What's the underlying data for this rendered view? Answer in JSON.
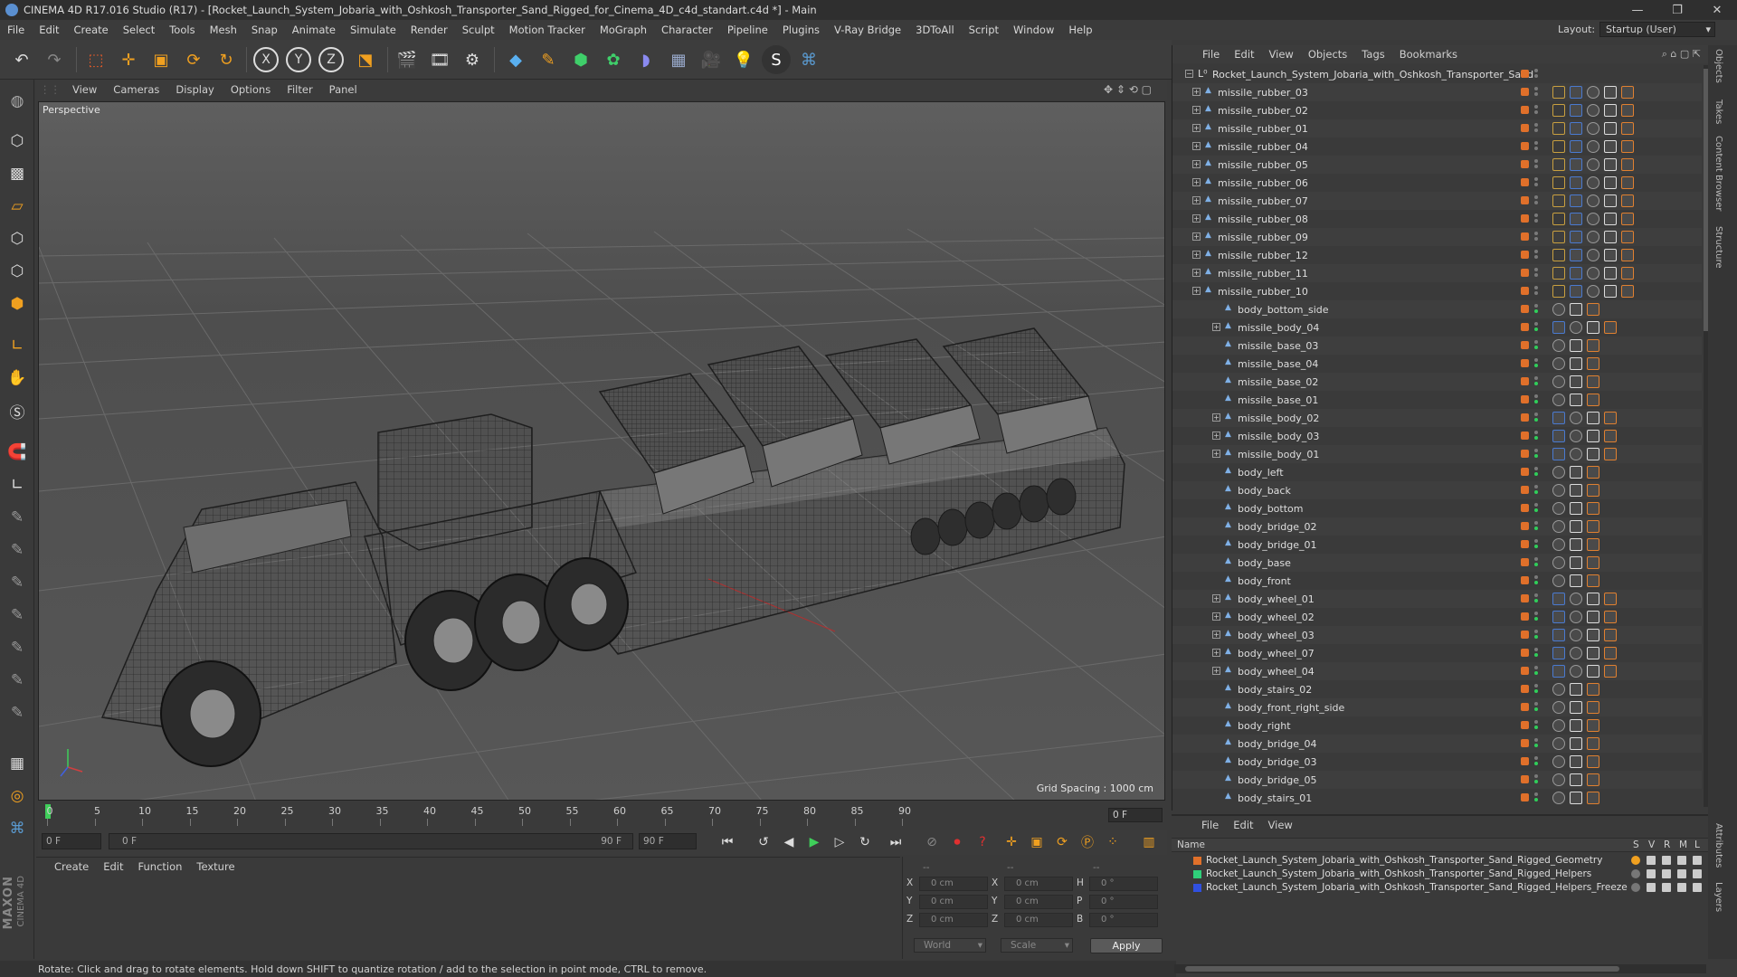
{
  "window": {
    "title": "CINEMA 4D R17.016 Studio (R17) - [Rocket_Launch_System_Jobaria_with_Oshkosh_Transporter_Sand_Rigged_for_Cinema_4D_c4d_standart.c4d *] - Main",
    "minimize": "—",
    "restore": "❐",
    "close": "✕"
  },
  "menubar": [
    "File",
    "Edit",
    "Create",
    "Select",
    "Tools",
    "Mesh",
    "Snap",
    "Animate",
    "Simulate",
    "Render",
    "Sculpt",
    "Motion Tracker",
    "MoGraph",
    "Character",
    "Pipeline",
    "Plugins",
    "V-Ray Bridge",
    "3DToAll",
    "Script",
    "Window",
    "Help"
  ],
  "layout": {
    "label": "Layout:",
    "value": "Startup (User)"
  },
  "viewport": {
    "menu": [
      "View",
      "Cameras",
      "Display",
      "Options",
      "Filter",
      "Panel"
    ],
    "label": "Perspective",
    "grid_spacing": "Grid Spacing : 1000 cm"
  },
  "timeline": {
    "ticks": [
      "0",
      "5",
      "10",
      "15",
      "20",
      "25",
      "30",
      "35",
      "40",
      "45",
      "50",
      "55",
      "60",
      "65",
      "70",
      "75",
      "80",
      "85",
      "90"
    ],
    "current_frame": "0 F"
  },
  "transport": {
    "start": "0 F",
    "slider_start": "0 F",
    "slider_end": "90 F",
    "end": "90 F"
  },
  "material_panel": {
    "menu": [
      "Create",
      "Edit",
      "Function",
      "Texture"
    ]
  },
  "coords": {
    "dash1": "--",
    "dash2": "--",
    "dash3": "--",
    "rows": [
      {
        "a": "X",
        "av": "0 cm",
        "b": "X",
        "bv": "0 cm",
        "c": "H",
        "cv": "0 °"
      },
      {
        "a": "Y",
        "av": "0 cm",
        "b": "Y",
        "bv": "0 cm",
        "c": "P",
        "cv": "0 °"
      },
      {
        "a": "Z",
        "av": "0 cm",
        "b": "Z",
        "bv": "0 cm",
        "c": "B",
        "cv": "0 °"
      }
    ],
    "world": "World",
    "scale": "Scale",
    "apply": "Apply"
  },
  "status": "Rotate: Click and drag to rotate elements. Hold down SHIFT to quantize rotation / add to the selection in point mode, CTRL to remove.",
  "object_manager": {
    "menu": [
      "File",
      "Edit",
      "View",
      "Objects",
      "Tags",
      "Bookmarks"
    ],
    "root": "Rocket_Launch_System_Jobaria_with_Oshkosh_Transporter_Sand",
    "rows": [
      {
        "name": "missile_rubber_03",
        "indent": 1,
        "exp": true
      },
      {
        "name": "missile_rubber_02",
        "indent": 1,
        "exp": true
      },
      {
        "name": "missile_rubber_01",
        "indent": 1,
        "exp": true
      },
      {
        "name": "missile_rubber_04",
        "indent": 1,
        "exp": true
      },
      {
        "name": "missile_rubber_05",
        "indent": 1,
        "exp": true
      },
      {
        "name": "missile_rubber_06",
        "indent": 1,
        "exp": true
      },
      {
        "name": "missile_rubber_07",
        "indent": 1,
        "exp": true
      },
      {
        "name": "missile_rubber_08",
        "indent": 1,
        "exp": true
      },
      {
        "name": "missile_rubber_09",
        "indent": 1,
        "exp": true
      },
      {
        "name": "missile_rubber_12",
        "indent": 1,
        "exp": true
      },
      {
        "name": "missile_rubber_11",
        "indent": 1,
        "exp": true
      },
      {
        "name": "missile_rubber_10",
        "indent": 1,
        "exp": true
      },
      {
        "name": "body_bottom_side",
        "indent": 2,
        "exp": false
      },
      {
        "name": "missile_body_04",
        "indent": 2,
        "exp": true
      },
      {
        "name": "missile_base_03",
        "indent": 2,
        "exp": false
      },
      {
        "name": "missile_base_04",
        "indent": 2,
        "exp": false
      },
      {
        "name": "missile_base_02",
        "indent": 2,
        "exp": false
      },
      {
        "name": "missile_base_01",
        "indent": 2,
        "exp": false
      },
      {
        "name": "missile_body_02",
        "indent": 2,
        "exp": true
      },
      {
        "name": "missile_body_03",
        "indent": 2,
        "exp": true
      },
      {
        "name": "missile_body_01",
        "indent": 2,
        "exp": true
      },
      {
        "name": "body_left",
        "indent": 2,
        "exp": false
      },
      {
        "name": "body_back",
        "indent": 2,
        "exp": false
      },
      {
        "name": "body_bottom",
        "indent": 2,
        "exp": false
      },
      {
        "name": "body_bridge_02",
        "indent": 2,
        "exp": false
      },
      {
        "name": "body_bridge_01",
        "indent": 2,
        "exp": false
      },
      {
        "name": "body_base",
        "indent": 2,
        "exp": false
      },
      {
        "name": "body_front",
        "indent": 2,
        "exp": false
      },
      {
        "name": "body_wheel_01",
        "indent": 2,
        "exp": true
      },
      {
        "name": "body_wheel_02",
        "indent": 2,
        "exp": true
      },
      {
        "name": "body_wheel_03",
        "indent": 2,
        "exp": true
      },
      {
        "name": "body_wheel_07",
        "indent": 2,
        "exp": true
      },
      {
        "name": "body_wheel_04",
        "indent": 2,
        "exp": true
      },
      {
        "name": "body_stairs_02",
        "indent": 2,
        "exp": false
      },
      {
        "name": "body_front_right_side",
        "indent": 2,
        "exp": false
      },
      {
        "name": "body_right",
        "indent": 2,
        "exp": false
      },
      {
        "name": "body_bridge_04",
        "indent": 2,
        "exp": false
      },
      {
        "name": "body_bridge_03",
        "indent": 2,
        "exp": false
      },
      {
        "name": "body_bridge_05",
        "indent": 2,
        "exp": false
      },
      {
        "name": "body_stairs_01",
        "indent": 2,
        "exp": false
      }
    ]
  },
  "layer_manager": {
    "menu": [
      "File",
      "Edit",
      "View"
    ],
    "header": {
      "name": "Name",
      "s": "S",
      "v": "V",
      "r": "R",
      "m": "M",
      "l": "L"
    },
    "layers": [
      {
        "name": "Rocket_Launch_System_Jobaria_with_Oshkosh_Transporter_Sand_Rigged_Geometry",
        "color": "#e0702a"
      },
      {
        "name": "Rocket_Launch_System_Jobaria_with_Oshkosh_Transporter_Sand_Rigged_Helpers",
        "color": "#2fcf7a"
      },
      {
        "name": "Rocket_Launch_System_Jobaria_with_Oshkosh_Transporter_Sand_Rigged_Helpers_Freeze",
        "color": "#3050e0"
      }
    ]
  },
  "side_tabs": [
    "Objects",
    "Takes",
    "Content Browser",
    "Structure"
  ],
  "side_tabs_bottom": [
    "Attributes",
    "Layers"
  ],
  "maxon": {
    "brand": "MAXON",
    "product": "CINEMA 4D"
  }
}
